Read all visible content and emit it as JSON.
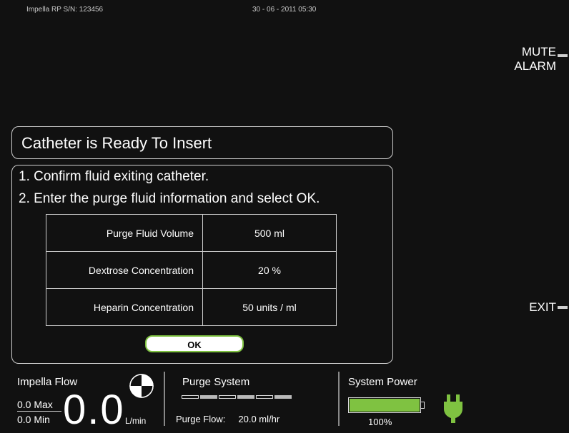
{
  "header": {
    "serial": "Impella RP S/N:  123456",
    "datetime": "30 - 06 - 2011   05:30"
  },
  "side_buttons": {
    "mute_line1": "MUTE",
    "mute_line2": "ALARM",
    "exit": "EXIT"
  },
  "dialog": {
    "title": "Catheter is Ready To Insert",
    "instruction1": "1. Confirm fluid exiting catheter.",
    "instruction2": "2. Enter the purge fluid information and select OK.",
    "rows": [
      {
        "label": "Purge Fluid Volume",
        "value": "500 ml"
      },
      {
        "label": "Dextrose Concentration",
        "value": "20 %"
      },
      {
        "label": "Heparin Concentration",
        "value": "50 units / ml"
      }
    ],
    "ok_label": "OK"
  },
  "status": {
    "impella_flow": {
      "title": "Impella  Flow",
      "max": "0.0 Max",
      "min": "0.0 Min",
      "value": "0.0",
      "unit": "L/min"
    },
    "purge_system": {
      "title": "Purge System",
      "segments_total": 6,
      "segments_filled": [
        false,
        true,
        false,
        true,
        false,
        true
      ],
      "flow_label": "Purge Flow:",
      "flow_value": "20.0  ml/hr"
    },
    "system_power": {
      "title": "System Power",
      "battery_percent": "100%",
      "battery_level": 1.0
    }
  },
  "colors": {
    "background": "#111111",
    "accent_green": "#7fc241",
    "border": "#cfcfcf"
  },
  "icons": {
    "fan": "fan-icon",
    "plug": "plug-icon"
  }
}
